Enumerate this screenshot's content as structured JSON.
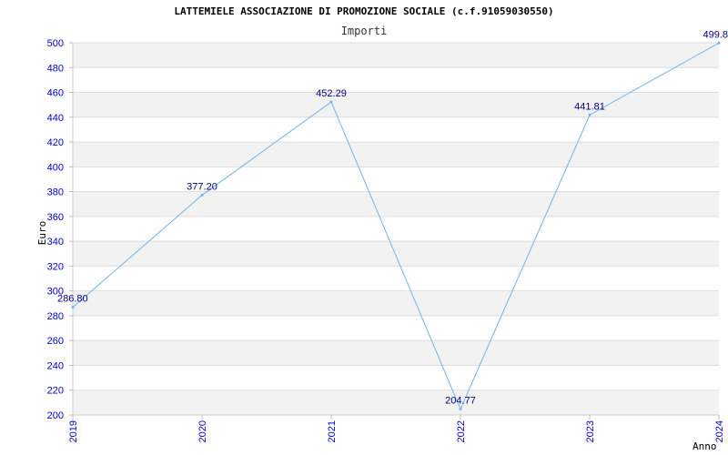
{
  "chart_data": {
    "type": "line",
    "title": "LATTEMIELE ASSOCIAZIONE DI PROMOZIONE SOCIALE (c.f.91059030550)",
    "subtitle": "Importi",
    "xlabel": "Anno",
    "ylabel": "Euro",
    "categories": [
      "2019",
      "2020",
      "2021",
      "2022",
      "2023",
      "2024"
    ],
    "values": [
      286.8,
      377.2,
      452.29,
      204.77,
      441.81,
      499.8
    ],
    "data_labels": [
      "286.80",
      "377.20",
      "452.29",
      "204.77",
      "441.81",
      "499.8"
    ],
    "ylim": [
      200,
      500
    ],
    "yticks": [
      200,
      220,
      240,
      260,
      280,
      300,
      320,
      340,
      360,
      380,
      400,
      420,
      440,
      460,
      480,
      500
    ],
    "grid": true,
    "line_color": "#6fb3ef",
    "band_color": "#f2f2f2",
    "tick_color": "#0000cc",
    "label_color": "#000080"
  }
}
